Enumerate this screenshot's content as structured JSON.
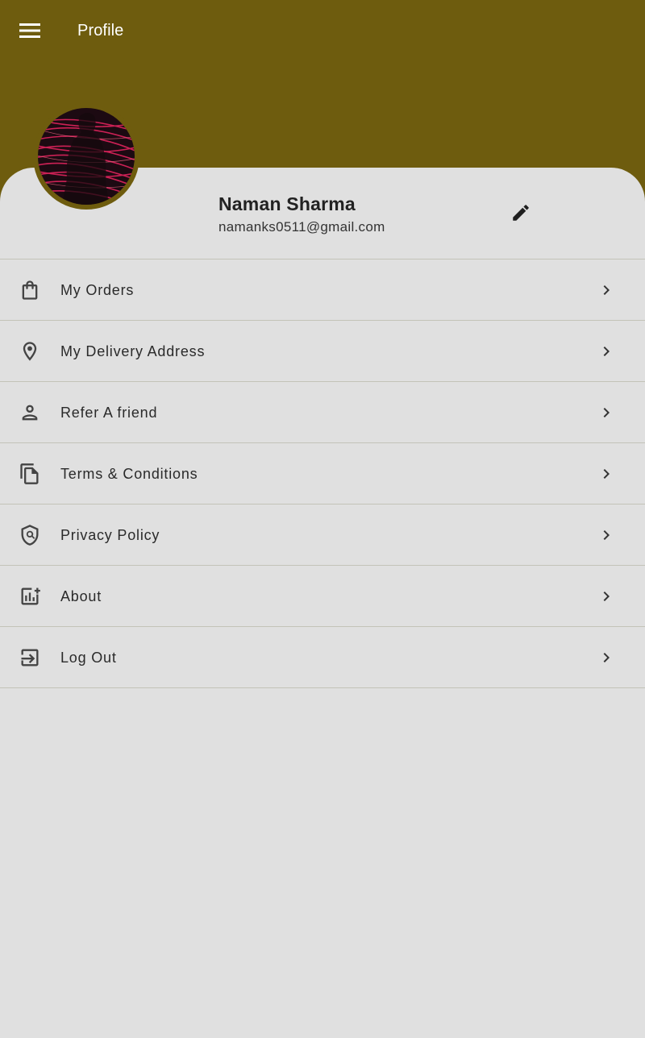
{
  "appbar": {
    "title": "Profile",
    "menu_icon": "hamburger-menu-icon"
  },
  "colors": {
    "header_bg": "#6e5c0e",
    "sheet_bg": "#e0e0e0",
    "divider": "#c3c3b8",
    "text_primary": "#222222",
    "icon": "#444444"
  },
  "profile": {
    "name": "Naman Sharma",
    "email": "namanks0511@gmail.com",
    "avatar": "profile-photo",
    "edit_icon": "pencil-icon"
  },
  "menu": [
    {
      "label": "My Orders",
      "icon": "shopping-bag-icon"
    },
    {
      "label": "My Delivery Address",
      "icon": "location-pin-icon"
    },
    {
      "label": "Refer A friend",
      "icon": "person-icon"
    },
    {
      "label": "Terms & Conditions",
      "icon": "documents-icon"
    },
    {
      "label": "Privacy Policy",
      "icon": "shield-icon"
    },
    {
      "label": "About",
      "icon": "analytics-icon"
    },
    {
      "label": "Log Out",
      "icon": "logout-icon"
    }
  ]
}
